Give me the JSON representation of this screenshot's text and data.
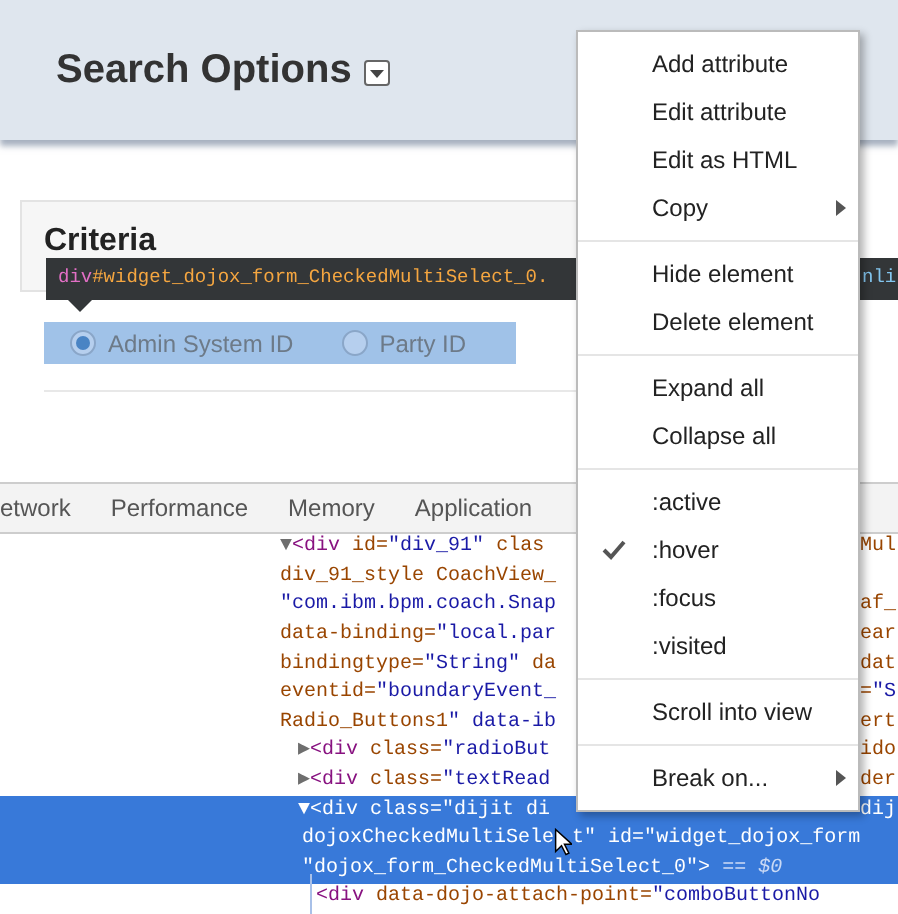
{
  "page": {
    "title": "Search Options",
    "section_title": "Criteria",
    "radios": [
      {
        "label": "Admin System ID",
        "selected": true
      },
      {
        "label": "Party ID",
        "selected": false
      }
    ]
  },
  "tooltip": {
    "tag": "div",
    "selector": "#widget_dojox_form_CheckedMultiSelect_0.",
    "tail": "nli"
  },
  "devtools": {
    "tabs": [
      {
        "label": "etwork"
      },
      {
        "label": "Performance"
      },
      {
        "label": "Memory"
      },
      {
        "label": "Application"
      }
    ],
    "tree": [
      {
        "selected": false,
        "lines": [
          {
            "left": "▼<div id=\"div_91\" clas",
            "right": "Mul"
          },
          {
            "left": "div_91_style CoachView_"
          },
          {
            "left": "\"com.ibm.bpm.coach.Snap",
            "right": "af_"
          },
          {
            "left": "data-binding=\"local.par",
            "right": "ear"
          },
          {
            "left": "bindingtype=\"String\" da",
            "right": "dat"
          },
          {
            "left": "eventid=\"boundaryEvent_",
            "right": "=\"S"
          },
          {
            "left": "Radio_Buttons1\" data-ib",
            "right": "ert"
          }
        ],
        "children": [
          {
            "selected": false,
            "lines": [
              {
                "left": "▶<div class=\"radioBut",
                "right": "ido"
              }
            ]
          },
          {
            "selected": false,
            "lines": [
              {
                "left": "▶<div class=\"textRead",
                "right": "der"
              }
            ]
          },
          {
            "selected": true,
            "lines": [
              {
                "left": "▼<div class=\"dijit di",
                "right": "dij"
              },
              {
                "left": "dojoxCheckedMultiSele",
                "after_cursor": "t\" id=\"widget_dojox_form"
              },
              {
                "left": "\"dojox_form_CheckedMultiSelect_0\"> == $0"
              }
            ],
            "children": [
              {
                "selected": false,
                "lines": [
                  {
                    "left": "<div data-dojo-attach-point=\"comboButtonNo"
                  }
                ]
              }
            ]
          }
        ]
      }
    ]
  },
  "context_menu": {
    "groups": [
      [
        {
          "label": "Add attribute",
          "checked": false,
          "submenu": false
        },
        {
          "label": "Edit attribute",
          "checked": false,
          "submenu": false
        },
        {
          "label": "Edit as HTML",
          "checked": false,
          "submenu": false
        },
        {
          "label": "Copy",
          "checked": false,
          "submenu": true
        }
      ],
      [
        {
          "label": "Hide element",
          "checked": false,
          "submenu": false
        },
        {
          "label": "Delete element",
          "checked": false,
          "submenu": false
        }
      ],
      [
        {
          "label": "Expand all",
          "checked": false,
          "submenu": false
        },
        {
          "label": "Collapse all",
          "checked": false,
          "submenu": false
        }
      ],
      [
        {
          "label": ":active",
          "checked": false,
          "submenu": false
        },
        {
          "label": ":hover",
          "checked": true,
          "submenu": false
        },
        {
          "label": ":focus",
          "checked": false,
          "submenu": false
        },
        {
          "label": ":visited",
          "checked": false,
          "submenu": false
        }
      ],
      [
        {
          "label": "Scroll into view",
          "checked": false,
          "submenu": false
        }
      ],
      [
        {
          "label": "Break on...",
          "checked": false,
          "submenu": true
        }
      ]
    ]
  }
}
